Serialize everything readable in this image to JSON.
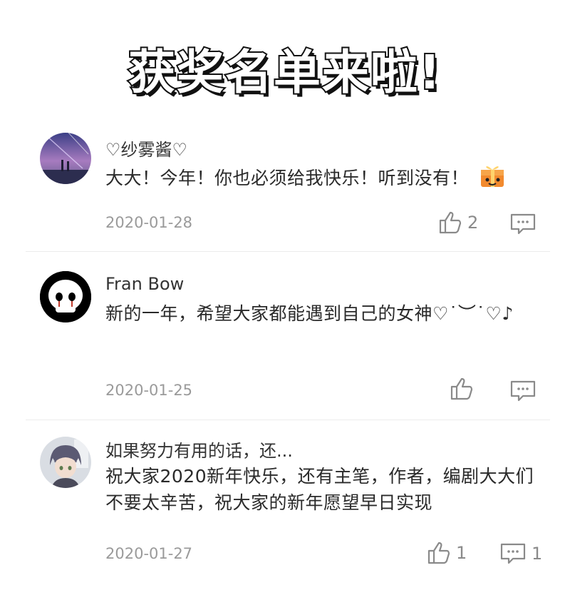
{
  "banner": {
    "title": "获奖名单来啦!"
  },
  "comments": [
    {
      "username": "♡纱雾酱♡",
      "text": "大大！今年！你也必须给我快乐！听到没有！",
      "date": "2020-01-28",
      "likes": "2",
      "replies": "",
      "emoji": "gift-emoji",
      "avatar": "anime-night-sky-avatar"
    },
    {
      "username": "Fran Bow",
      "text": "新的一年，希望大家都能遇到自己的女神♡˙︶˙♡♪",
      "date": "2020-01-25",
      "likes": "",
      "replies": "",
      "avatar": "skull-face-avatar"
    },
    {
      "username": "如果努力有用的话，还...",
      "text": "祝大家2020新年快乐，还有主笔，作者，编剧大大们不要太辛苦，祝大家的新年愿望早日实现",
      "date": "2020-01-27",
      "likes": "1",
      "replies": "1",
      "avatar": "anime-boy-avatar"
    }
  ],
  "colors": {
    "meta_gray": "#9a9a9a",
    "icon_gray": "#8a8a8a",
    "divider": "#ececec"
  },
  "icons": {
    "like": "thumbs-up-icon",
    "reply": "comment-bubble-icon"
  }
}
